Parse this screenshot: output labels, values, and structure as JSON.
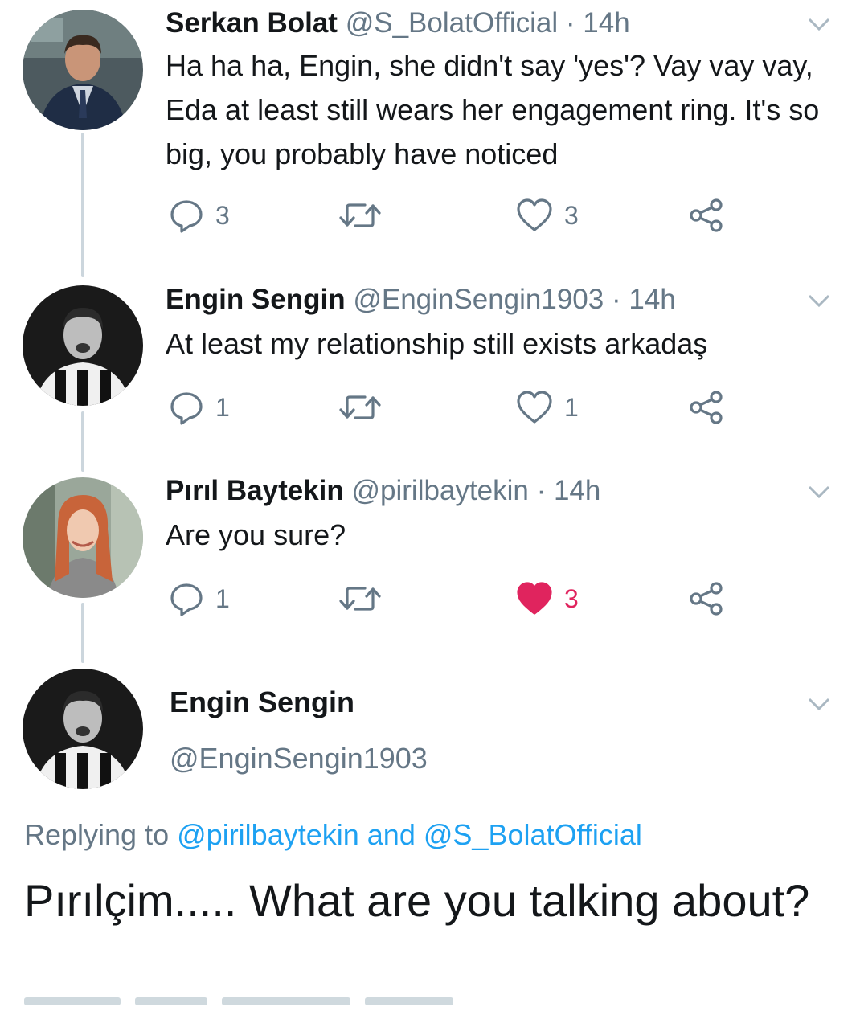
{
  "tweets": [
    {
      "name": "Serkan Bolat",
      "handle": "@S_BolatOfficial",
      "time": "· 14h",
      "text": "Ha ha ha, Engin, she didn't say 'yes'? Vay vay vay, Eda at least still wears her engagement ring. It's so big, you probably have noticed",
      "replies": "3",
      "likes": "3",
      "liked": false
    },
    {
      "name": "Engin Sengin",
      "handle": "@EnginSengin1903",
      "time": "· 14h",
      "text": "At least my relationship still exists arkadaş",
      "replies": "1",
      "likes": "1",
      "liked": false
    },
    {
      "name": "Pırıl Baytekin",
      "handle": "@pirilbaytekin",
      "time": "· 14h",
      "text": "Are you sure?",
      "replies": "1",
      "likes": "3",
      "liked": true
    }
  ],
  "focus_tweet": {
    "name": "Engin Sengin",
    "handle": "@EnginSengin1903",
    "replying_prefix": "Replying to",
    "mention_1": "@pirilbaytekin",
    "and_word": "and",
    "mention_2": "@S_BolatOfficial",
    "text": "Pırılçim..... What are you talking about?"
  },
  "colors": {
    "like_active": "#e0245e",
    "link": "#1da1f2",
    "muted": "#657786",
    "thread_line": "#ccd6dd"
  },
  "icons": [
    "reply-icon",
    "retweet-icon",
    "heart-icon",
    "share-icon",
    "chevron-down-icon"
  ]
}
